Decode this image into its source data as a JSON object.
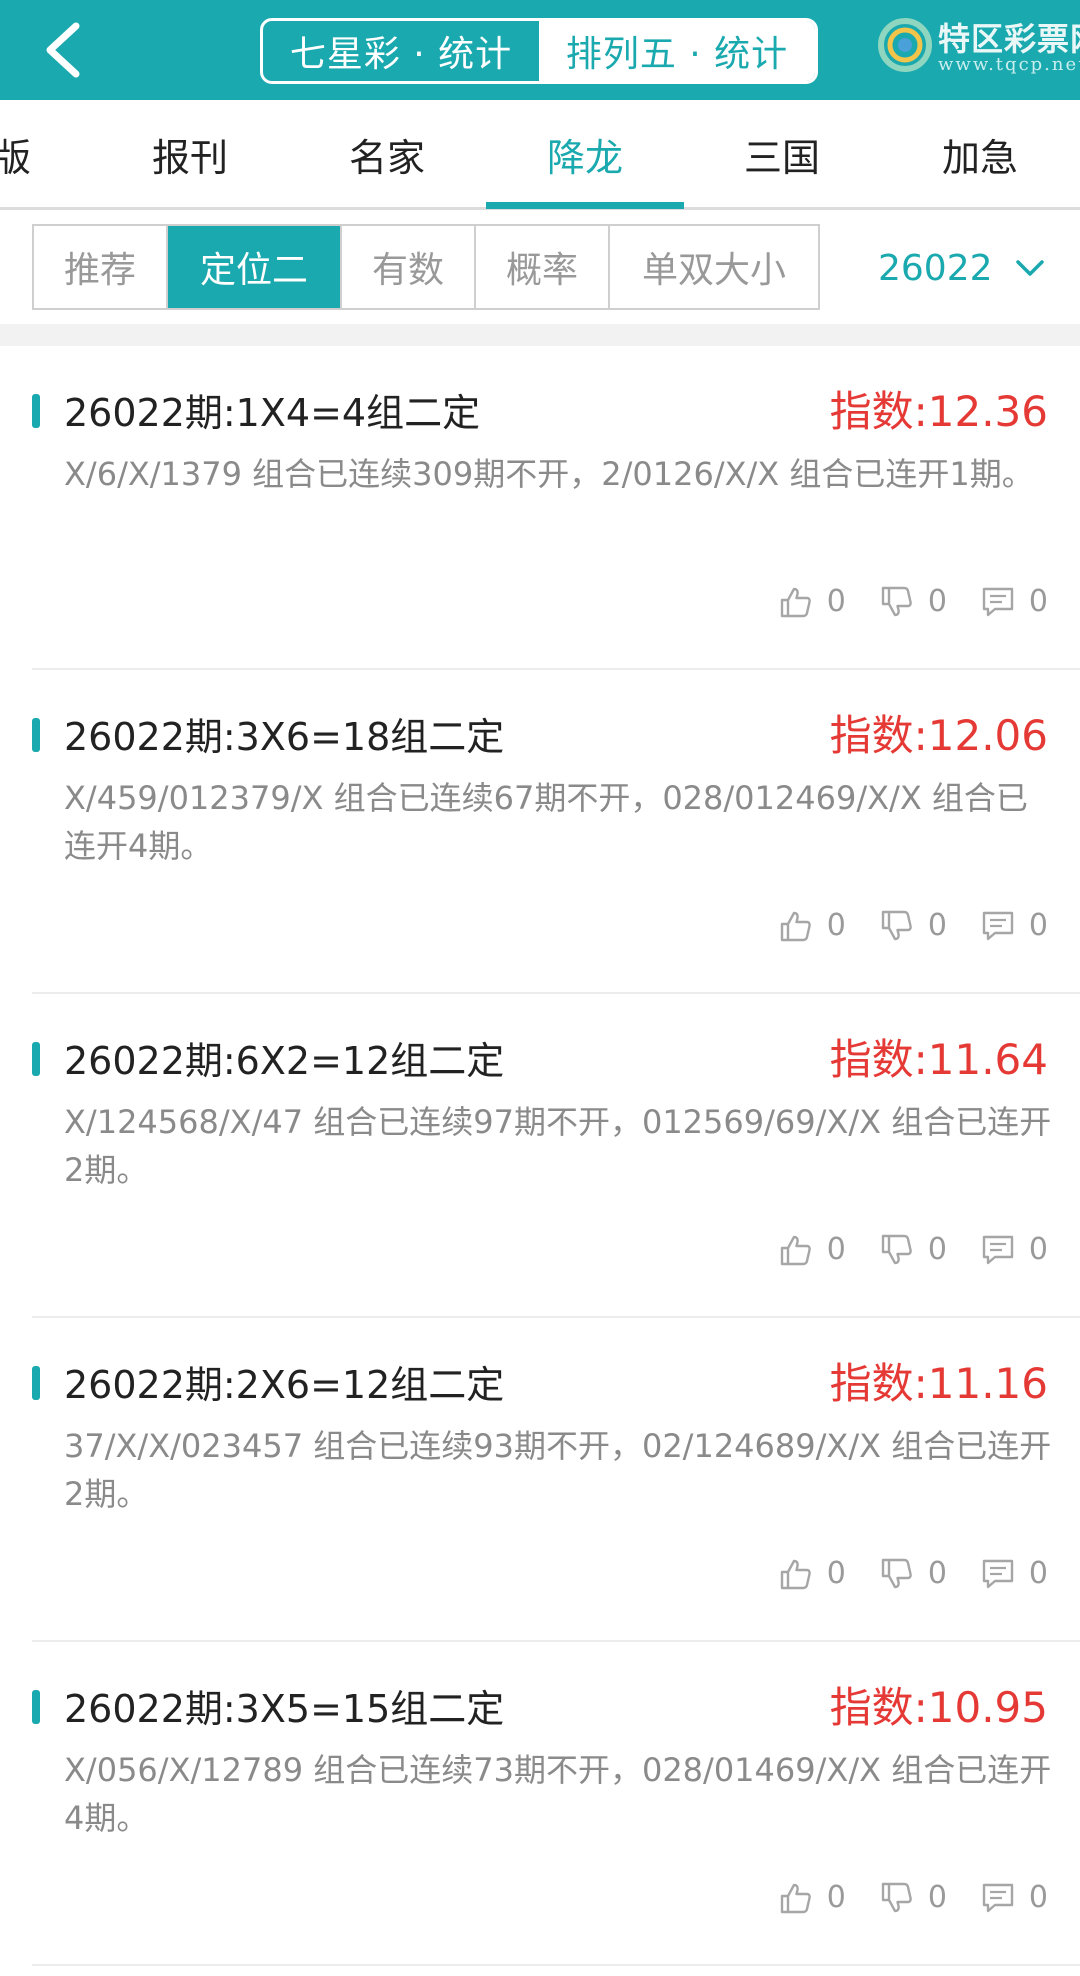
{
  "header": {
    "segments": [
      {
        "label": "七星彩 · 统计",
        "active": true
      },
      {
        "label": "排列五 · 统计",
        "active": false
      }
    ],
    "logo": {
      "title": "特区彩票网",
      "subtitle": "www.tqcp.net"
    }
  },
  "tabs": [
    {
      "label": "版",
      "active": false
    },
    {
      "label": "报刊",
      "active": false
    },
    {
      "label": "名家",
      "active": false
    },
    {
      "label": "降龙",
      "active": true
    },
    {
      "label": "三国",
      "active": false
    },
    {
      "label": "加急",
      "active": false
    }
  ],
  "filters": [
    {
      "label": "推荐",
      "active": false
    },
    {
      "label": "定位二",
      "active": true
    },
    {
      "label": "有数",
      "active": false
    },
    {
      "label": "概率",
      "active": false
    },
    {
      "label": "单双大小",
      "active": false
    }
  ],
  "period": {
    "value": "26022"
  },
  "items": [
    {
      "title": "26022期:1X4=4组二定",
      "index": "指数:12.36",
      "desc": "X/6/X/1379 组合已连续309期不开，2/0126/X/X 组合已连开1期。",
      "likes": "0",
      "dislikes": "0",
      "comments": "0"
    },
    {
      "title": "26022期:3X6=18组二定",
      "index": "指数:12.06",
      "desc": "X/459/012379/X 组合已连续67期不开，028/012469/X/X 组合已连开4期。",
      "likes": "0",
      "dislikes": "0",
      "comments": "0"
    },
    {
      "title": "26022期:6X2=12组二定",
      "index": "指数:11.64",
      "desc": "X/124568/X/47 组合已连续97期不开，012569/69/X/X 组合已连开2期。",
      "likes": "0",
      "dislikes": "0",
      "comments": "0"
    },
    {
      "title": "26022期:2X6=12组二定",
      "index": "指数:11.16",
      "desc": "37/X/X/023457 组合已连续93期不开，02/124689/X/X 组合已连开2期。",
      "likes": "0",
      "dislikes": "0",
      "comments": "0"
    },
    {
      "title": "26022期:3X5=15组二定",
      "index": "指数:10.95",
      "desc": "X/056/X/12789 组合已连续73期不开，028/01469/X/X 组合已连开4期。",
      "likes": "0",
      "dislikes": "0",
      "comments": "0"
    }
  ]
}
